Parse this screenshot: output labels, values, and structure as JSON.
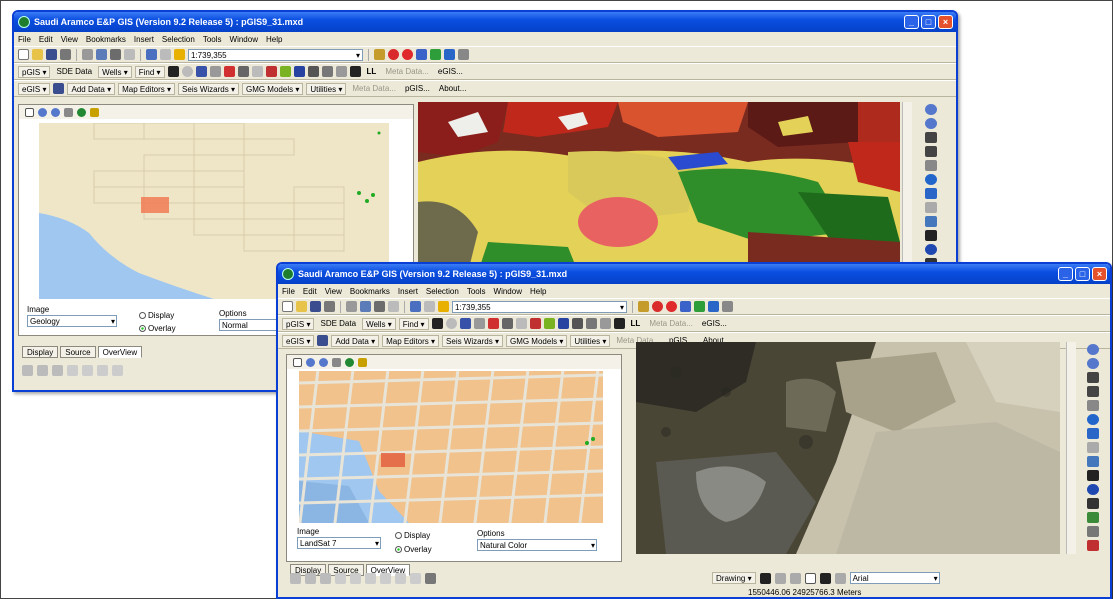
{
  "window_back": {
    "title": "Saudi Aramco E&P GIS (Version 9.2 Release 5) : pGIS9_31.mxd",
    "scale": "1:739,355",
    "image_layer": "Geology",
    "display_label": "Display",
    "overlay_label": "Overlay",
    "options_label": "Options",
    "options_value": "Normal",
    "tabs": [
      "Display",
      "Source",
      "OverView"
    ]
  },
  "window_front": {
    "title": "Saudi Aramco E&P GIS (Version 9.2 Release 5) : pGIS9_31.mxd",
    "scale": "1:739,355",
    "image_label": "Image",
    "image_layer": "LandSat 7",
    "display_label": "Display",
    "overlay_label": "Overlay",
    "options_label": "Options",
    "options_value": "Natural Color",
    "tabs": [
      "Display",
      "Source",
      "OverView"
    ],
    "drawing_label": "Drawing",
    "font_value": "Arial",
    "coordinates": "1550446.06 24925766.3 Meters"
  },
  "menu": [
    "File",
    "Edit",
    "View",
    "Bookmarks",
    "Insert",
    "Selection",
    "Tools",
    "Window",
    "Help"
  ],
  "toolbar2": [
    "pGIS",
    "SDE Data",
    "Wells",
    "Find",
    "LL",
    "Meta Data...",
    "eGIS..."
  ],
  "toolbar3": [
    "eGIS",
    "Add Data",
    "Map Editors",
    "Seis Wizards",
    "GMG Models",
    "Utilities",
    "Meta Data...",
    "pGIS...",
    "About..."
  ],
  "colors": {
    "title_blue": "#0a4ee0",
    "chrome": "#ece9d8",
    "geology_red": "#c0281b",
    "geology_yellow": "#e3d257",
    "geology_green": "#2f8d2a",
    "overview_tan": "#f1c28c",
    "sea_blue": "#9fc7ef"
  }
}
